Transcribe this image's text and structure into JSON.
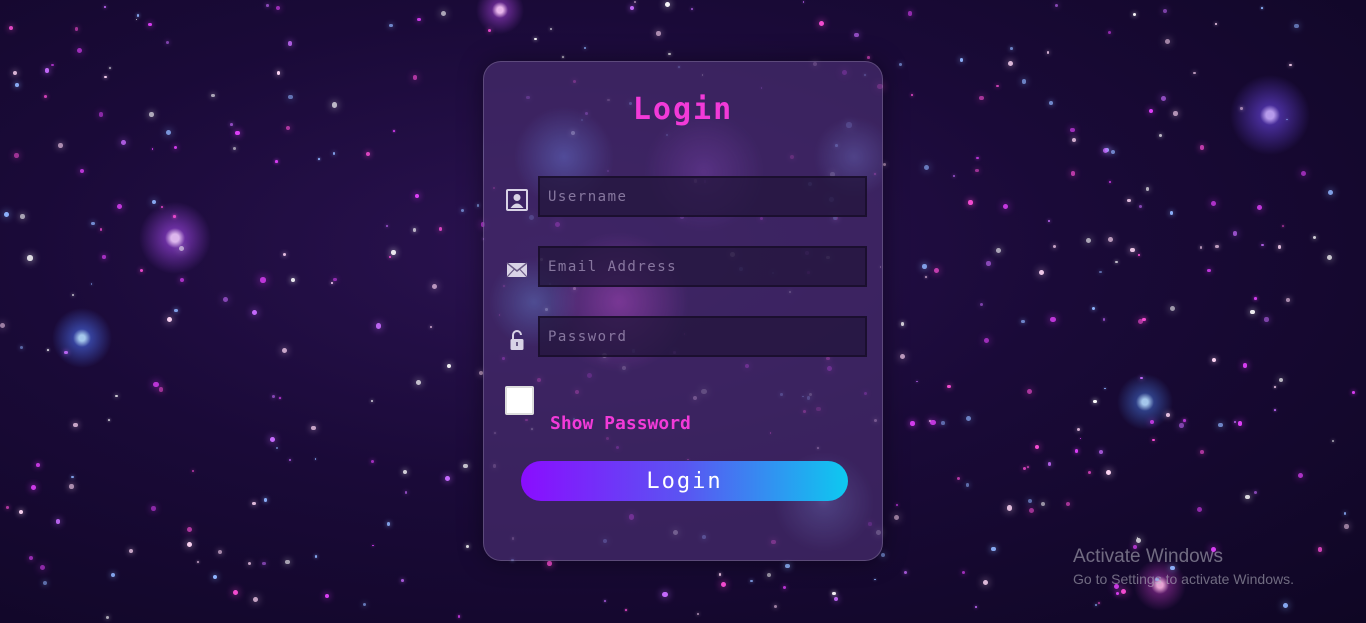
{
  "login_card": {
    "title": "Login",
    "username": {
      "placeholder": "Username",
      "icon": "user-icon"
    },
    "email": {
      "placeholder": "Email Address",
      "icon": "envelope-icon"
    },
    "password": {
      "placeholder": "Password",
      "icon": "lock-icon"
    },
    "show_password": {
      "label": "Show Password",
      "checked": false
    },
    "submit_label": "Login"
  },
  "watermark": {
    "title": "Activate Windows",
    "subtitle": "Go to Settings to activate Windows."
  },
  "colors": {
    "accent_pink": "#f23ad8",
    "button_gradient_start": "#8a0dff",
    "button_gradient_end": "#0dc9f0",
    "background": "#1a0a38"
  }
}
